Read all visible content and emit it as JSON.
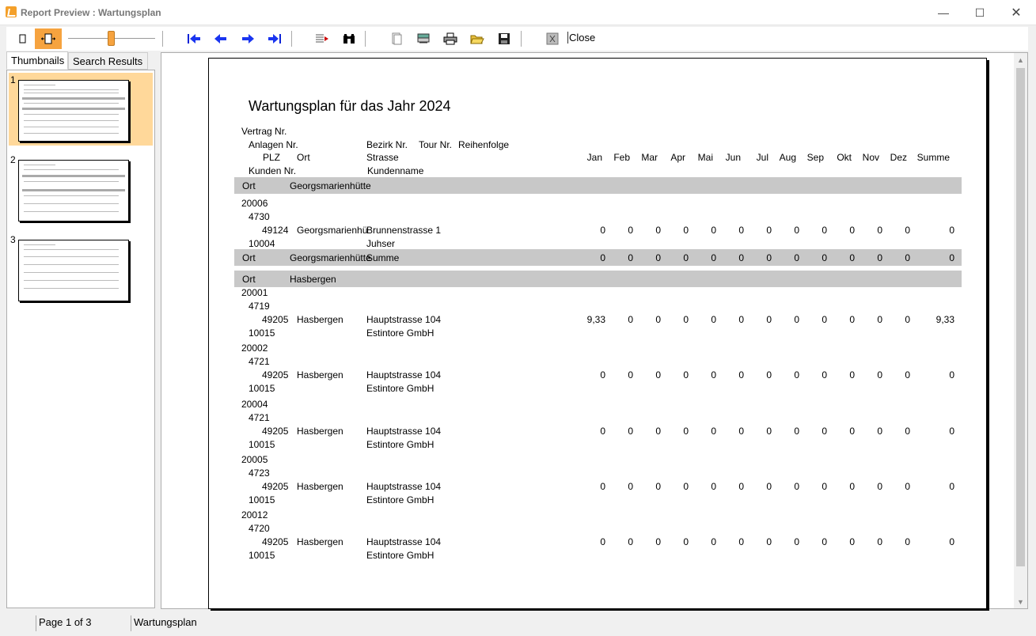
{
  "window": {
    "title": "Report Preview : Wartungsplan"
  },
  "toolbar": {
    "close_label": "Close"
  },
  "tabs": [
    "Thumbnails",
    "Search Results"
  ],
  "thumbnails": [
    "1",
    "2",
    "3"
  ],
  "report": {
    "title": "Wartungsplan für das Jahr 2024",
    "header": {
      "vertrag": "Vertrag Nr.",
      "anlagen": "Anlagen Nr.",
      "plz": "PLZ",
      "ort": "Ort",
      "bezirk": "Bezirk Nr.",
      "tour": "Tour Nr.",
      "reihenfolge": "Reihenfolge",
      "strasse": "Strasse",
      "kunden": "Kunden Nr.",
      "kundenname": "Kundenname",
      "months": [
        "Jan",
        "Feb",
        "Mar",
        "Apr",
        "Mai",
        "Jun",
        "Jul",
        "Aug",
        "Sep",
        "Okt",
        "Nov",
        "Dez"
      ],
      "summe": "Summe"
    },
    "group_label": "Ort",
    "summe_label": "Summe",
    "groups": [
      {
        "ort": "Georgsmarienhütte",
        "records": [
          {
            "vertrag": "20006",
            "anlage": "4730",
            "plz": "49124",
            "ort": "Georgsmarienhü",
            "strasse": "Brunnenstrasse 1",
            "kunde": "10004",
            "kundenname": "Juhser",
            "values": [
              "0",
              "0",
              "0",
              "0",
              "0",
              "0",
              "0",
              "0",
              "0",
              "0",
              "0",
              "0"
            ],
            "summe": "0"
          }
        ],
        "total": {
          "ort": "Georgsmarienhütte",
          "values": [
            "0",
            "0",
            "0",
            "0",
            "0",
            "0",
            "0",
            "0",
            "0",
            "0",
            "0",
            "0"
          ],
          "summe": "0"
        }
      },
      {
        "ort": "Hasbergen",
        "records": [
          {
            "vertrag": "20001",
            "anlage": "4719",
            "plz": "49205",
            "ort": "Hasbergen",
            "strasse": "Hauptstrasse 104",
            "kunde": "10015",
            "kundenname": "Estintore GmbH",
            "values": [
              "9,33",
              "0",
              "0",
              "0",
              "0",
              "0",
              "0",
              "0",
              "0",
              "0",
              "0",
              "0"
            ],
            "summe": "9,33"
          },
          {
            "vertrag": "20002",
            "anlage": "4721",
            "plz": "49205",
            "ort": "Hasbergen",
            "strasse": "Hauptstrasse 104",
            "kunde": "10015",
            "kundenname": "Estintore GmbH",
            "values": [
              "0",
              "0",
              "0",
              "0",
              "0",
              "0",
              "0",
              "0",
              "0",
              "0",
              "0",
              "0"
            ],
            "summe": "0"
          },
          {
            "vertrag": "20004",
            "anlage": "4721",
            "plz": "49205",
            "ort": "Hasbergen",
            "strasse": "Hauptstrasse 104",
            "kunde": "10015",
            "kundenname": "Estintore GmbH",
            "values": [
              "0",
              "0",
              "0",
              "0",
              "0",
              "0",
              "0",
              "0",
              "0",
              "0",
              "0",
              "0"
            ],
            "summe": "0"
          },
          {
            "vertrag": "20005",
            "anlage": "4723",
            "plz": "49205",
            "ort": "Hasbergen",
            "strasse": "Hauptstrasse 104",
            "kunde": "10015",
            "kundenname": "Estintore GmbH",
            "values": [
              "0",
              "0",
              "0",
              "0",
              "0",
              "0",
              "0",
              "0",
              "0",
              "0",
              "0",
              "0"
            ],
            "summe": "0"
          },
          {
            "vertrag": "20012",
            "anlage": "4720",
            "plz": "49205",
            "ort": "Hasbergen",
            "strasse": "Hauptstrasse 104",
            "kunde": "10015",
            "kundenname": "Estintore GmbH",
            "values": [
              "0",
              "0",
              "0",
              "0",
              "0",
              "0",
              "0",
              "0",
              "0",
              "0",
              "0",
              "0"
            ],
            "summe": "0"
          }
        ]
      }
    ]
  },
  "status": {
    "page": "Page 1 of 3",
    "report_name": "Wartungsplan"
  }
}
